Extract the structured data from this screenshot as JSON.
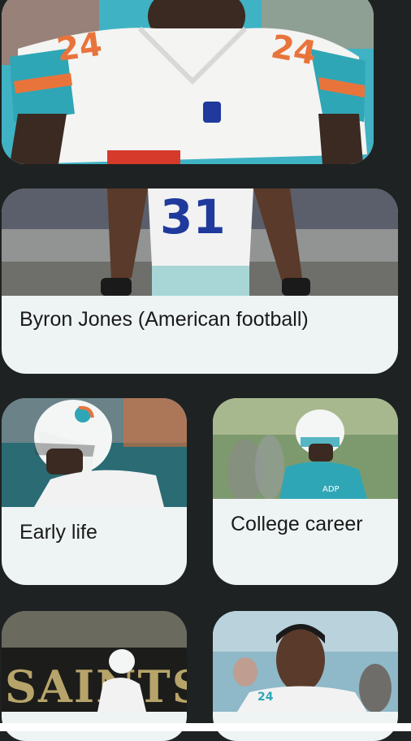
{
  "cards": {
    "main": {
      "title": "Byron Jones (American football)"
    },
    "early_life": {
      "title": "Early life"
    },
    "college_career": {
      "title": "College career"
    }
  },
  "colors": {
    "page_background": "#1e2222",
    "card_background": "#eef4f3",
    "dolphins_aqua": "#2fa6b6",
    "dolphins_orange": "#e8743c",
    "cowboys_blue": "#1f3a9c"
  }
}
